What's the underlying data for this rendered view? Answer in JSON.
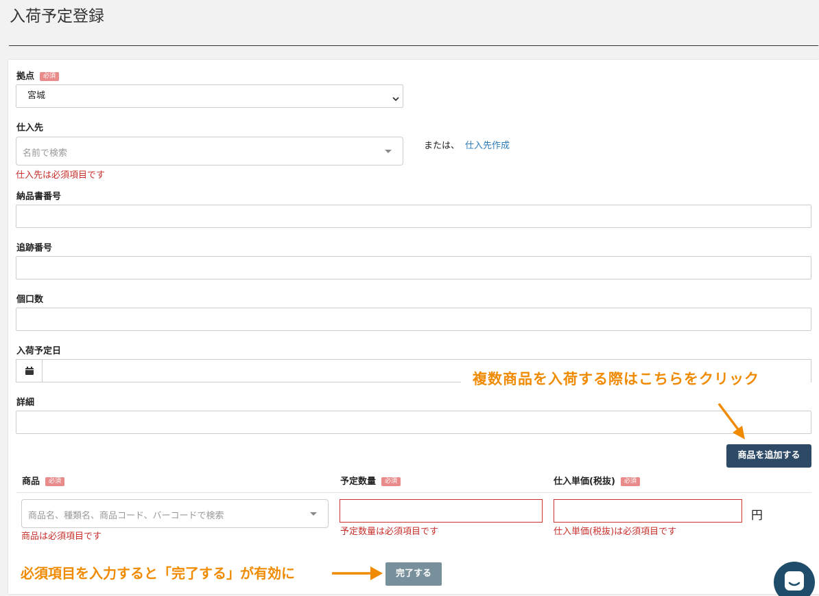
{
  "page": {
    "title": "入荷予定登録"
  },
  "form": {
    "base": {
      "label": "拠点",
      "required_badge": "必須",
      "value": "宮城"
    },
    "supplier": {
      "label": "仕入先",
      "placeholder": "名前で検索",
      "error": "仕入先は必須項目です",
      "or_text": "または、",
      "create_link": "仕入先作成"
    },
    "delivery_note": {
      "label": "納品書番号",
      "value": ""
    },
    "tracking": {
      "label": "追跡番号",
      "value": ""
    },
    "packages": {
      "label": "個口数",
      "value": ""
    },
    "arrival_date": {
      "label": "入荷予定日",
      "value": "",
      "icon": "calendar-icon"
    },
    "details": {
      "label": "詳細",
      "value": ""
    }
  },
  "products": {
    "add_button": "商品を追加する",
    "headers": [
      {
        "label": "商品",
        "badge": "必須"
      },
      {
        "label": "予定数量",
        "badge": "必須"
      },
      {
        "label": "仕入単価(税抜)",
        "badge": "必須"
      }
    ],
    "row": {
      "product_placeholder": "商品名、種類名、商品コード、バーコードで検索",
      "product_error": "商品は必須項目です",
      "quantity_error": "予定数量は必須項目です",
      "price_error": "仕入単価(税抜)は必須項目です",
      "unit": "円"
    }
  },
  "annotations": {
    "add_hint": "複数商品を入荷する際はこちらをクリック",
    "complete_hint": "必須項目を入力すると「完了する」が有効に"
  },
  "footer": {
    "complete_button": "完了する"
  },
  "colors": {
    "accent_orange": "#f08a00",
    "error_red": "#c9302c",
    "primary_dark": "#2c4a66",
    "link_blue": "#2a7ab8"
  }
}
